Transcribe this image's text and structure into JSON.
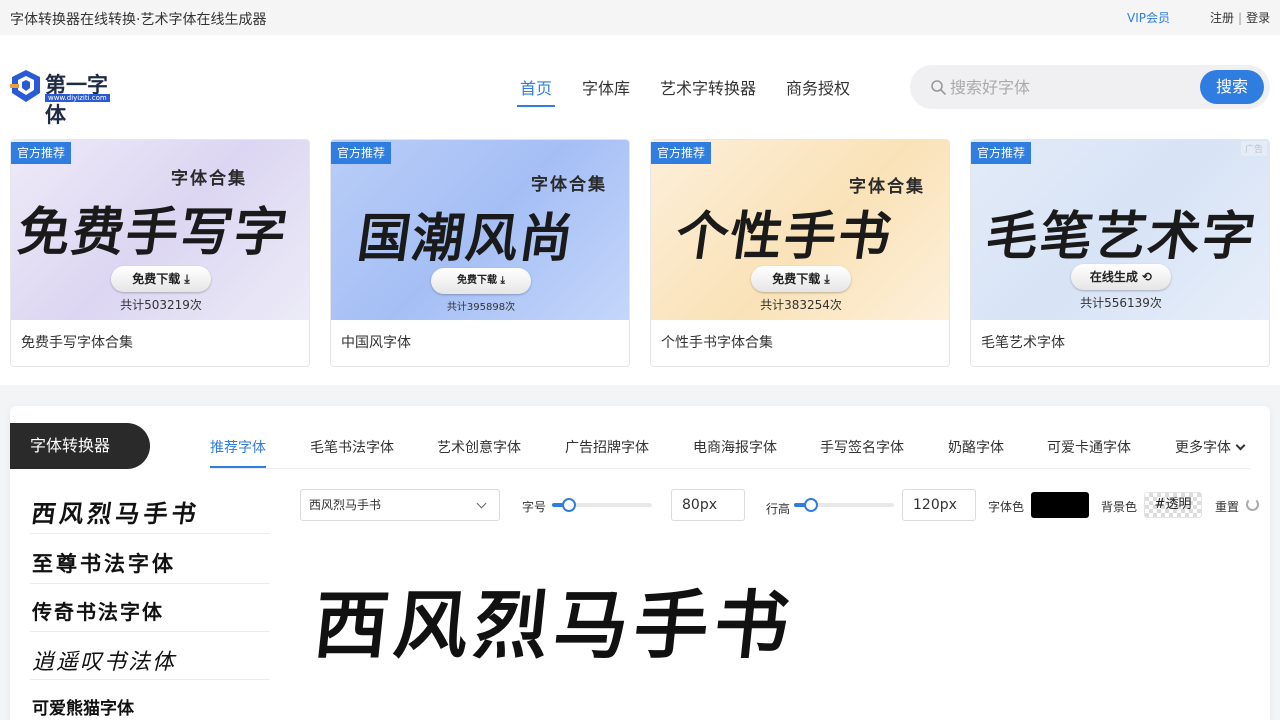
{
  "topbar": {
    "site_title": "字体转换器在线转换·艺术字体在线生成器",
    "vip_label": "VIP会员",
    "register_label": "注册",
    "separator": "|",
    "login_label": "登录"
  },
  "header": {
    "logo_name": "第一字体",
    "logo_url": "www.diyiziti.com",
    "nav": [
      "首页",
      "字体库",
      "艺术字转换器",
      "商务授权"
    ],
    "active_nav": "首页",
    "search": {
      "placeholder": "搜索好字体",
      "button_label": "搜索"
    }
  },
  "cards": [
    {
      "badge": "官方推荐",
      "subtitle": "字体合集",
      "big_text": "免费手写字",
      "button": "免费下载 ⤓",
      "count": "共计503219次",
      "caption": "免费手写字体合集",
      "ad": ""
    },
    {
      "badge": "官方推荐",
      "subtitle": "字体合集",
      "big_text": "国潮风尚",
      "button": "免费下载 ⤓",
      "count": "共计395898次",
      "caption": "中国风字体",
      "ad": ""
    },
    {
      "badge": "官方推荐",
      "subtitle": "字体合集",
      "big_text": "个性手书",
      "button": "免费下载 ⤓",
      "count": "共计383254次",
      "caption": "个性手书字体合集",
      "ad": ""
    },
    {
      "badge": "官方推荐",
      "subtitle": "",
      "big_text": "毛笔艺术字",
      "button": "在线生成 ⟲",
      "count": "共计556139次",
      "caption": "毛笔艺术字体",
      "ad": "广告"
    }
  ],
  "converter": {
    "title": "字体转换器",
    "tabs": [
      "推荐字体",
      "毛笔书法字体",
      "艺术创意字体",
      "广告招牌字体",
      "电商海报字体",
      "手写签名字体",
      "奶酪字体",
      "可爱卡通字体",
      "更多字体"
    ],
    "active_tab": "推荐字体",
    "font_list": [
      "西风烈马手书",
      "至尊书法字体",
      "传奇书法字体",
      "逍遥叹书法体",
      "可爱熊猫字体"
    ],
    "controls": {
      "selected_font": "西风烈马手书",
      "size_label": "字号",
      "size_value": "80px",
      "size_slider_fraction": 0.12,
      "line_height_label": "行高",
      "line_height_value": "120px",
      "line_height_slider_fraction": 0.12,
      "font_color_label": "字体色",
      "font_color": "#000000",
      "bg_color_label": "背景色",
      "bg_color_value": "#透明",
      "reset_label": "重置"
    },
    "preview_text": "西风烈马手书"
  },
  "colors": {
    "accent": "#2f7de1",
    "dark_pill": "#2a2a2a"
  }
}
